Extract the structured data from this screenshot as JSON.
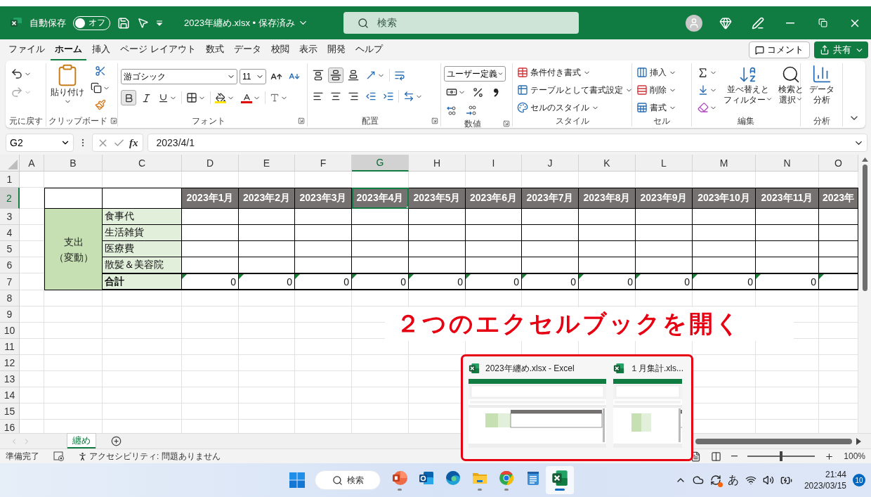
{
  "title_bar": {
    "autosave_label": "自動保存",
    "autosave_on": false,
    "autosave_state": "オフ",
    "file_title": "2023年纏め.xlsx • 保存済み",
    "search_placeholder": "検索"
  },
  "menu_tabs": [
    {
      "label": "ファイル",
      "selected": false
    },
    {
      "label": "ホーム",
      "selected": true
    },
    {
      "label": "挿入",
      "selected": false
    },
    {
      "label": "ページ レイアウト",
      "selected": false
    },
    {
      "label": "数式",
      "selected": false
    },
    {
      "label": "データ",
      "selected": false
    },
    {
      "label": "校閲",
      "selected": false
    },
    {
      "label": "表示",
      "selected": false
    },
    {
      "label": "開発",
      "selected": false
    },
    {
      "label": "ヘルプ",
      "selected": false
    }
  ],
  "comment_button": "コメント",
  "share_button": "共有",
  "ribbon": {
    "groups": [
      "元に戻す",
      "クリップボード",
      "フォント",
      "配置",
      "数値",
      "スタイル",
      "セル",
      "編集",
      "分析"
    ],
    "paste_label": "貼り付け",
    "font_name": "游ゴシック",
    "font_size": "11",
    "number_format": "ユーザー定義",
    "style_buttons": [
      "条件付き書式",
      "テーブルとして書式設定",
      "セルのスタイル"
    ],
    "cell_buttons": [
      "挿入",
      "削除",
      "書式"
    ],
    "sort_filter": [
      "並べ替えと",
      "フィルター"
    ],
    "find_select": [
      "検索と",
      "選択"
    ],
    "data_analysis": [
      "データ",
      "分析"
    ]
  },
  "formula_bar": {
    "name_box": "G2",
    "function_label": "fx",
    "formula": "2023/4/1"
  },
  "sheet": {
    "columns": [
      {
        "label": "A",
        "selected": false
      },
      {
        "label": "B",
        "selected": false
      },
      {
        "label": "C",
        "selected": false
      },
      {
        "label": "D",
        "selected": false
      },
      {
        "label": "E",
        "selected": false
      },
      {
        "label": "F",
        "selected": false
      },
      {
        "label": "G",
        "selected": true
      },
      {
        "label": "H",
        "selected": false
      },
      {
        "label": "I",
        "selected": false
      },
      {
        "label": "J",
        "selected": false
      },
      {
        "label": "K",
        "selected": false
      },
      {
        "label": "L",
        "selected": false
      },
      {
        "label": "M",
        "selected": false
      },
      {
        "label": "N",
        "selected": false
      },
      {
        "label": "O",
        "selected": false
      }
    ],
    "rows": [
      {
        "label": "1",
        "selected": false
      },
      {
        "label": "2",
        "selected": true
      },
      {
        "label": "3",
        "selected": false
      },
      {
        "label": "4",
        "selected": false
      },
      {
        "label": "5",
        "selected": false
      },
      {
        "label": "6",
        "selected": false
      },
      {
        "label": "7",
        "selected": false
      },
      {
        "label": "8",
        "selected": false
      },
      {
        "label": "9",
        "selected": false
      },
      {
        "label": "10",
        "selected": false
      },
      {
        "label": "11",
        "selected": false
      },
      {
        "label": "12",
        "selected": false
      },
      {
        "label": "13",
        "selected": false
      },
      {
        "label": "14",
        "selected": false
      },
      {
        "label": "15",
        "selected": false
      },
      {
        "label": "16",
        "selected": false
      }
    ],
    "category": [
      "支出",
      "（変動）"
    ],
    "months": [
      {
        "label": "2023年1月",
        "selected": false
      },
      {
        "label": "2023年2月",
        "selected": false
      },
      {
        "label": "2023年3月",
        "selected": false
      },
      {
        "label": "2023年4月",
        "selected": true
      },
      {
        "label": "2023年5月",
        "selected": false
      },
      {
        "label": "2023年6月",
        "selected": false
      },
      {
        "label": "2023年7月",
        "selected": false
      },
      {
        "label": "2023年8月",
        "selected": false
      },
      {
        "label": "2023年9月",
        "selected": false
      },
      {
        "label": "2023年10月",
        "selected": false
      },
      {
        "label": "2023年11月",
        "selected": false
      },
      {
        "label": "2023年",
        "selected": false
      }
    ],
    "items": [
      "食事代",
      "生活雑貨",
      "医療費",
      "散髪＆美容院"
    ],
    "total_label": "合計",
    "totals": [
      "0",
      "0",
      "0",
      "0",
      "0",
      "0",
      "0",
      "0",
      "0",
      "0",
      "0"
    ]
  },
  "sheet_tabs": [
    {
      "label": "纏め",
      "selected": true
    }
  ],
  "status_bar": {
    "ready": "準備完了",
    "accessibility": "アクセシビリティ: 問題ありません",
    "zoom": {
      "level": 0.5,
      "reading": "100%"
    }
  },
  "annotation": "２つのエクセルブックを開く",
  "window_previews": [
    {
      "title": "2023年纏め.xlsx - Excel",
      "kind": "wide"
    },
    {
      "title": "１月集計.xls...",
      "kind": "narrow"
    }
  ],
  "taskbar": {
    "search": "検索",
    "apps": [
      {
        "kind": "presentation",
        "running": true,
        "active": false
      },
      {
        "kind": "mail",
        "running": false,
        "active": false
      },
      {
        "kind": "browser",
        "running": false,
        "active": false
      },
      {
        "kind": "folder",
        "running": true,
        "active": false
      },
      {
        "kind": "chrome",
        "running": true,
        "active": false
      },
      {
        "kind": "notepad",
        "running": false,
        "active": false
      },
      {
        "kind": "spreadsheet",
        "running": true,
        "active": true
      }
    ],
    "ime": "あ",
    "time": "21:44",
    "date": "2023/03/15",
    "notifications": "10"
  }
}
